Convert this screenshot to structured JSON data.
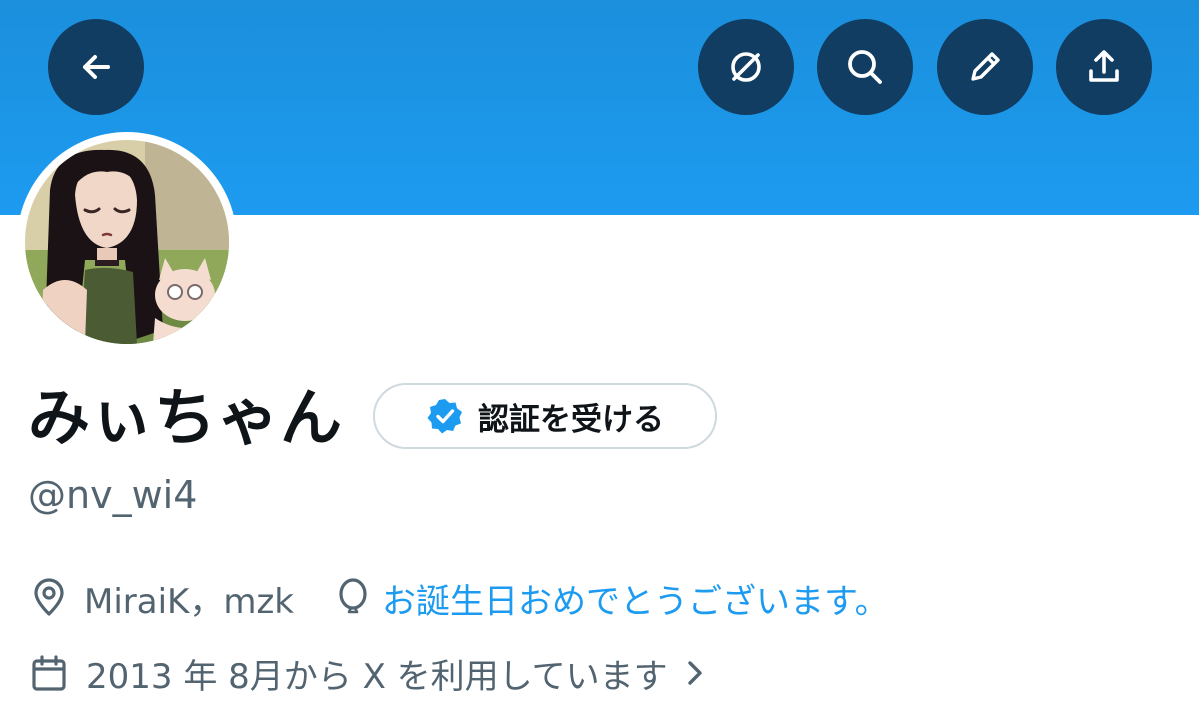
{
  "header": {
    "buttons": [
      {
        "name": "back",
        "icon": "arrow-left-icon"
      },
      {
        "name": "explore",
        "icon": "explore-icon"
      },
      {
        "name": "search",
        "icon": "search-icon"
      },
      {
        "name": "edit",
        "icon": "pencil-icon"
      },
      {
        "name": "share",
        "icon": "share-icon"
      }
    ],
    "banner_color": "#1d9bf0",
    "button_color": "#103d61"
  },
  "profile": {
    "avatar_icon": "avatar-image",
    "display_name": "みぃちゃん",
    "verify_button": {
      "label": "認証を受ける",
      "icon": "verified-badge-icon",
      "badge_color": "#1d9bf0"
    },
    "handle": "@nv_wi4",
    "location": {
      "icon": "location-pin-icon",
      "text": "MiraiK，mzk"
    },
    "birthday": {
      "icon": "balloon-icon",
      "text": "お誕生日おめでとうございます。",
      "color": "#1d9bf0"
    },
    "joined": {
      "icon": "calendar-icon",
      "text": "2013 年 8月から X を利用しています",
      "chevron_icon": "chevron-right-icon"
    }
  }
}
